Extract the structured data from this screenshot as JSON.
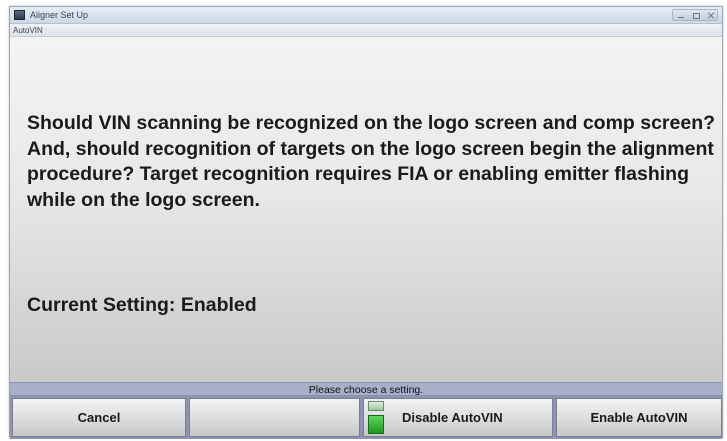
{
  "window": {
    "title": "Aligner Set Up",
    "tab": "AutoVIN"
  },
  "message": {
    "body": "Should VIN scanning be recognized on the logo screen and comp screen?  And, should recognition of targets on the logo screen begin the alignment procedure?  Target recognition requires FIA or enabling emitter flashing while on the logo screen.",
    "current_setting": "Current Setting: Enabled"
  },
  "status": {
    "text": "Please choose a setting."
  },
  "buttons": {
    "cancel": "Cancel",
    "empty": "",
    "disable": "Disable AutoVIN",
    "enable": "Enable AutoVIN"
  },
  "colors": {
    "status_bar": "#a9afc8",
    "button_bar": "#8e94b0",
    "indicator_green": "#2fb02f"
  },
  "icons": {
    "app": "app-icon",
    "indicator": "led-indicator-icon"
  }
}
